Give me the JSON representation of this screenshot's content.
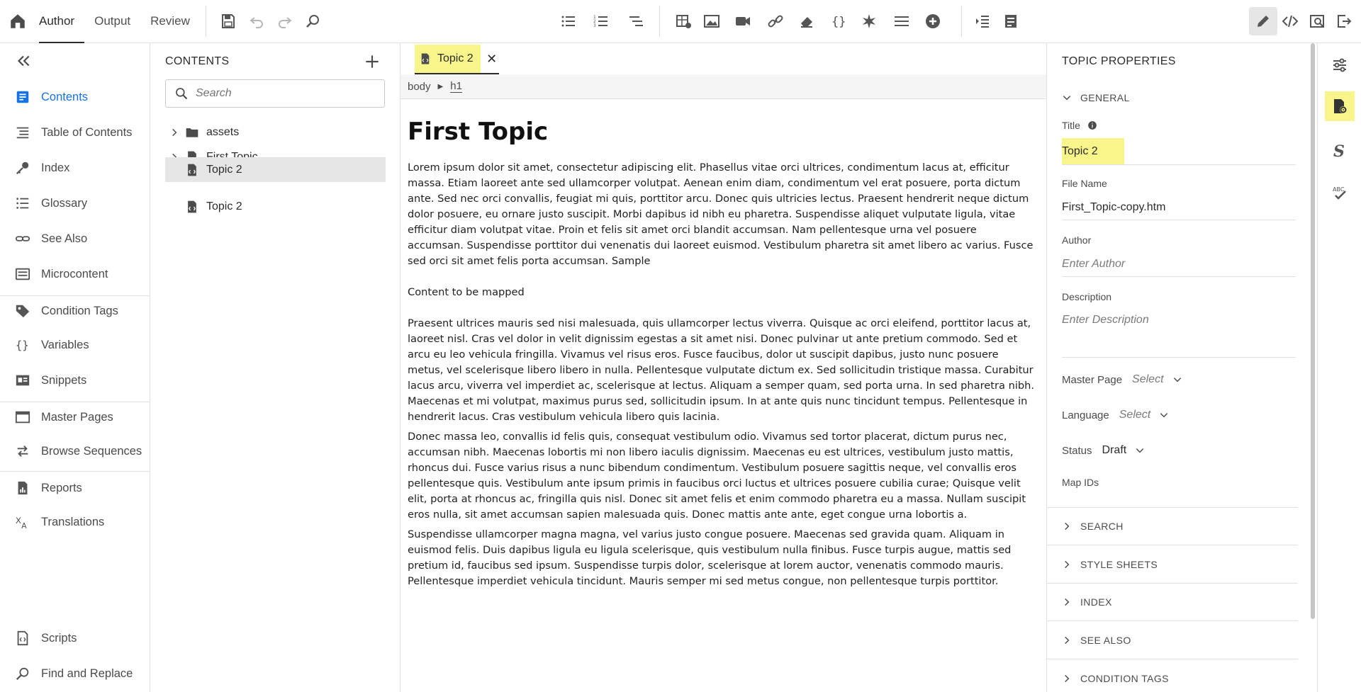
{
  "topnav": {
    "tabs": [
      {
        "label": "Author",
        "active": true
      },
      {
        "label": "Output",
        "active": false
      },
      {
        "label": "Review",
        "active": false
      }
    ]
  },
  "leftnav": {
    "items": [
      {
        "label": "Contents",
        "icon": "contents-icon",
        "active": true
      },
      {
        "label": "Table of Contents",
        "icon": "toc-icon"
      },
      {
        "label": "Index",
        "icon": "index-key-icon"
      },
      {
        "label": "Glossary",
        "icon": "glossary-list-icon"
      },
      {
        "label": "See Also",
        "icon": "see-also-link-icon"
      },
      {
        "label": "Microcontent",
        "icon": "microcontent-icon"
      },
      {
        "label": "Condition Tags",
        "icon": "tag-icon"
      },
      {
        "label": "Variables",
        "icon": "braces-icon"
      },
      {
        "label": "Snippets",
        "icon": "snippet-icon"
      },
      {
        "label": "Master Pages",
        "icon": "master-page-icon"
      },
      {
        "label": "Browse Sequences",
        "icon": "browse-sequence-icon"
      },
      {
        "label": "Reports",
        "icon": "report-icon"
      },
      {
        "label": "Translations",
        "icon": "translate-icon"
      },
      {
        "label": "Scripts",
        "icon": "script-icon"
      },
      {
        "label": "Find and Replace",
        "icon": "find-replace-icon"
      }
    ]
  },
  "contents": {
    "title": "CONTENTS",
    "search_placeholder": "Search",
    "tree": [
      {
        "label": "assets",
        "type": "folder",
        "expandable": true
      },
      {
        "label": "First Topic",
        "type": "topic",
        "expandable": true
      },
      {
        "label": "Topic 2",
        "type": "topic",
        "selected": true
      },
      {
        "label": "Topic 2",
        "type": "topic"
      }
    ]
  },
  "editor": {
    "tab_label": "Topic 2",
    "breadcrumb": [
      "body",
      "h1"
    ],
    "heading": "First Topic",
    "paragraphs": [
      "Lorem ipsum dolor sit amet, consectetur adipiscing elit. Phasellus vitae orci ultrices, condimentum lacus at, efficitur massa. Etiam laoreet ante sed ullamcorper volutpat. Aenean enim diam, condimentum vel erat posuere, porta dictum ante. Sed nec orci convallis, feugiat mi quis, porttitor arcu. Donec quis ultricies lectus. Praesent hendrerit neque dictum dolor posuere, eu ornare justo suscipit. Morbi dapibus id nibh eu pharetra. Suspendisse aliquet vulputate ligula, vitae efficitur diam volutpat vitae. Proin et felis sit amet orci blandit accumsan. Nam pellentesque urna vel posuere accumsan. Suspendisse porttitor dui venenatis dui laoreet euismod. Vestibulum pharetra sit amet libero ac varius. Fusce sed orci sit amet felis porta accumsan. Sample",
      "Content to be mapped",
      "Praesent ultrices mauris sed nisi malesuada, quis ullamcorper lectus viverra. Quisque ac orci eleifend, porttitor lacus at, laoreet nisl. Cras vel dolor in velit dignissim egestas a sit amet nisi. Donec pulvinar ut ante pretium commodo. Sed et arcu eu leo vehicula fringilla. Vivamus vel risus eros. Fusce faucibus, dolor ut suscipit dapibus, justo nunc posuere metus, vel scelerisque libero libero in nulla. Pellentesque vulputate dictum ex. Sed sollicitudin tristique massa. Curabitur lacus arcu, viverra vel imperdiet ac, scelerisque at lectus. Aliquam a semper quam, sed porta urna. In sed pharetra nibh. Maecenas et mi volutpat, maximus purus sed, sollicitudin ipsum. In at ante quis nunc tincidunt tempus. Pellentesque in hendrerit lacus. Cras vestibulum vehicula libero quis lacinia.",
      "Donec massa leo, convallis id felis quis, consequat vestibulum odio. Vivamus sed tortor placerat, dictum purus nec, accumsan nibh. Maecenas lobortis mi non libero iaculis dignissim. Maecenas eu est ultrices, vestibulum justo mattis, rhoncus dui. Fusce varius risus a nunc bibendum condimentum. Vestibulum posuere sagittis neque, vel convallis eros pellentesque quis. Vestibulum ante ipsum primis in faucibus orci luctus et ultrices posuere cubilia curae; Quisque velit elit, porta at rhoncus ac, fringilla quis nisl. Donec sit amet felis et enim commodo pharetra eu a massa. Nullam suscipit eros nulla, sit amet accumsan sapien malesuada quis. Donec mattis ante ante, eget congue urna lobortis a.",
      "Suspendisse ullamcorper magna magna, vel varius justo congue posuere. Maecenas sed gravida quam. Aliquam in euismod felis. Duis dapibus ligula eu ligula scelerisque, quis vestibulum nulla finibus. Fusce turpis augue, mattis sed pretium id, faucibus sed ipsum. Suspendisse turpis dolor, scelerisque at lorem auctor, venenatis commodo mauris. Pellentesque imperdiet vehicula tincidunt. Mauris semper mi sed metus congue, non pellentesque turpis porttitor."
    ]
  },
  "properties": {
    "title": "TOPIC PROPERTIES",
    "general_label": "GENERAL",
    "title_label": "Title",
    "title_value": "Topic 2",
    "filename_label": "File Name",
    "filename_value": "First_Topic-copy.htm",
    "author_label": "Author",
    "author_placeholder": "Enter Author",
    "description_label": "Description",
    "description_placeholder": "Enter Description",
    "master_page_label": "Master Page",
    "master_page_value": "Select",
    "language_label": "Language",
    "language_value": "Select",
    "status_label": "Status",
    "status_value": "Draft",
    "map_ids_label": "Map IDs",
    "sections": [
      "SEARCH",
      "STYLE SHEETS",
      "INDEX",
      "SEE ALSO",
      "CONDITION TAGS"
    ]
  },
  "colors": {
    "accent": "#1473e6",
    "highlight": "#f8f58a",
    "selected_row": "#e6e6e6"
  }
}
